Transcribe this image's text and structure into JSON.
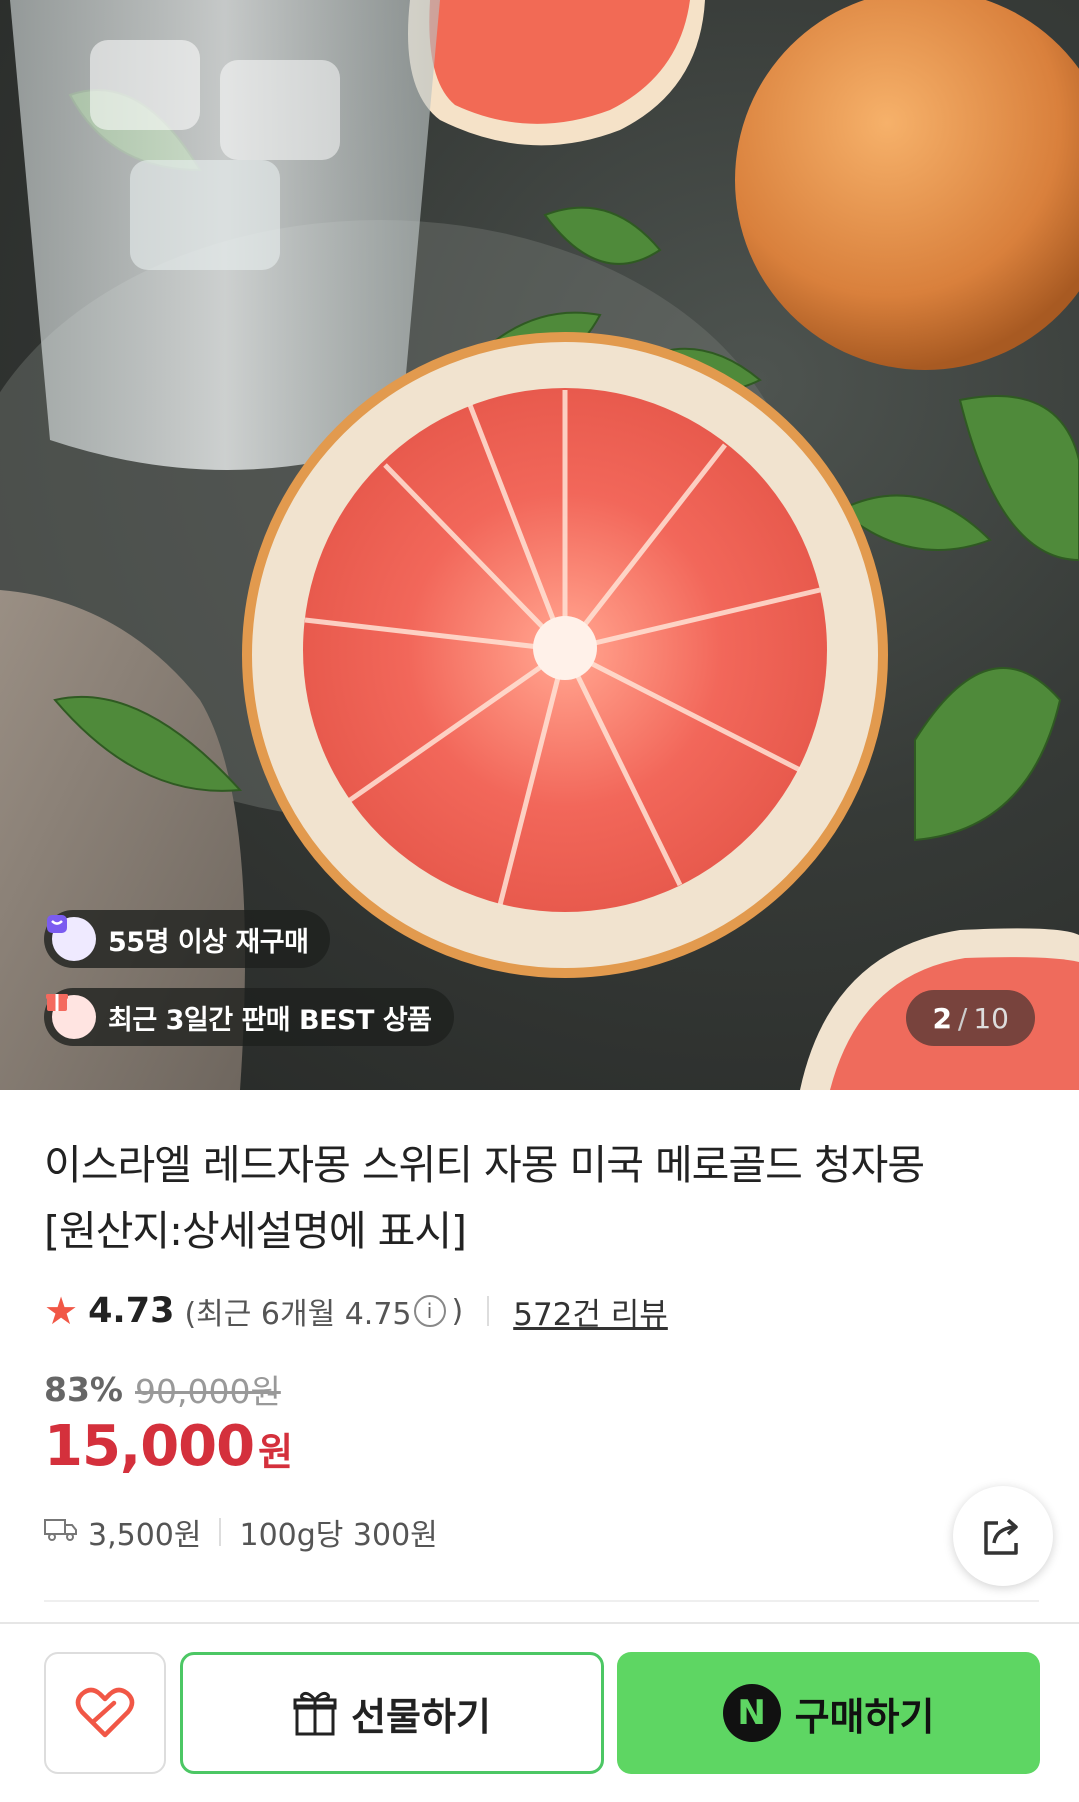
{
  "hero": {
    "badges": [
      {
        "label": "55명 이상 재구매",
        "icon": "shopping-bag-icon",
        "icon_color": "#7b5cf0"
      },
      {
        "label": "최근 3일간 판매 BEST 상품",
        "icon": "gift-icon",
        "icon_color": "#f46a5e"
      }
    ],
    "counter": {
      "current": "2",
      "separator": "/",
      "total": "10"
    }
  },
  "product": {
    "title_line1": "이스라엘 레드자몽 스위티 자몽 미국 메로골드 청자몽",
    "title_line2": "[원산지:상세설명에 표시]",
    "rating": {
      "score": "4.73",
      "recent_prefix": "(최근 6개월 4.75",
      "recent_suffix": ")",
      "reviews": "572건 리뷰"
    },
    "discount_percent": "83%",
    "original_price": "90,000원",
    "price": "15,000",
    "price_unit": "원",
    "shipping_fee": "3,500원",
    "unit_price": "100g당 300원"
  },
  "actions": {
    "gift_label": "선물하기",
    "buy_label": "구매하기",
    "buy_logo": "N"
  },
  "colors": {
    "accent_green": "#5ed663",
    "price_red": "#d4303c",
    "star": "#f15746"
  }
}
